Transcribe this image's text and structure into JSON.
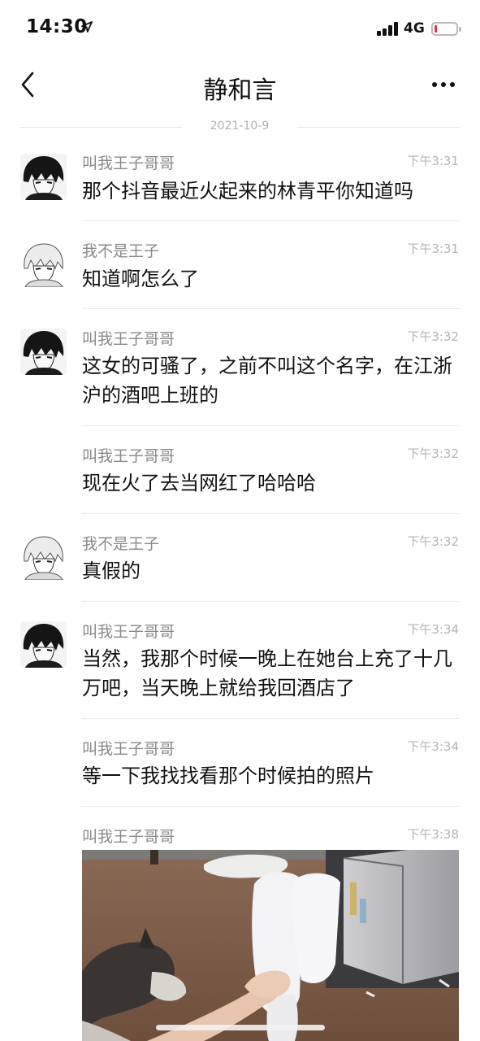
{
  "status_bar": {
    "time": "14:30",
    "network": "4G",
    "battery_level": 0.12
  },
  "header": {
    "title": "静和言",
    "back_icon": "chevron-left-icon",
    "more_icon": "more-horizontal-icon"
  },
  "date_divider": "2021-10-9",
  "messages": [
    {
      "sender": "叫我王子哥哥",
      "time": "下午3:31",
      "text": "那个抖音最近火起来的林青平你知道吗",
      "avatar": "dark-hair-anime-avatar"
    },
    {
      "sender": "我不是王子",
      "time": "下午3:31",
      "text": "知道啊怎么了",
      "avatar": "light-hair-anime-avatar"
    },
    {
      "sender": "叫我王子哥哥",
      "time": "下午3:32",
      "text": "这女的可骚了，之前不叫这个名字，在江浙沪的酒吧上班的",
      "avatar": "dark-hair-anime-avatar"
    },
    {
      "sender": "叫我王子哥哥",
      "time": "下午3:32",
      "text": "现在火了去当网红了哈哈哈",
      "avatar": ""
    },
    {
      "sender": "我不是王子",
      "time": "下午3:32",
      "text": "真假的",
      "avatar": "light-hair-anime-avatar"
    },
    {
      "sender": "叫我王子哥哥",
      "time": "下午3:34",
      "text": "当然，我那个时候一晚上在她台上充了十几万吧，当天晚上就给我回酒店了",
      "avatar": "dark-hair-anime-avatar"
    },
    {
      "sender": "叫我王子哥哥",
      "time": "下午3:34",
      "text": "等一下我找找看那个时候拍的照片",
      "avatar": ""
    },
    {
      "sender": "叫我王子哥哥",
      "time": "下午3:38",
      "text": "",
      "avatar": "",
      "image": "room-photo-with-dog"
    }
  ],
  "colors": {
    "name": "#8a8a8a",
    "time": "#b5b5b5",
    "battery_low": "#e5303a"
  }
}
